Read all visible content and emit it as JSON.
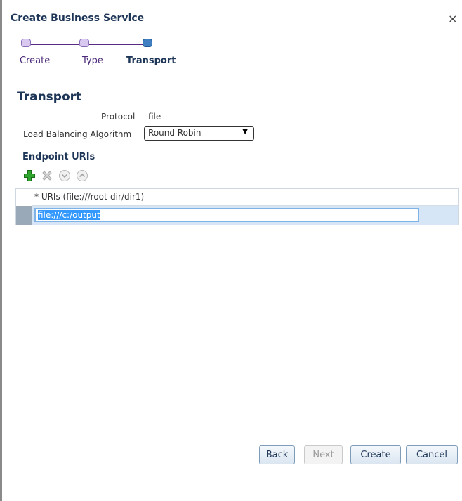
{
  "dialog": {
    "title": "Create Business Service",
    "close_label": "×"
  },
  "train": {
    "steps": [
      {
        "label": "Create",
        "state": "visited"
      },
      {
        "label": "Type",
        "state": "visited"
      },
      {
        "label": "Transport",
        "state": "current"
      }
    ]
  },
  "section": {
    "title": "Transport",
    "protocol_label": "Protocol",
    "protocol_value": "file",
    "lb_label": "Load Balancing Algorithm",
    "lb_value": "Round Robin"
  },
  "endpoints": {
    "title": "Endpoint URIs",
    "toolbar": [
      {
        "name": "add-icon",
        "enabled": true
      },
      {
        "name": "delete-icon",
        "enabled": false
      },
      {
        "name": "move-down-icon",
        "enabled": false
      },
      {
        "name": "move-up-icon",
        "enabled": false
      }
    ],
    "column_header": "* URIs (file:///root-dir/dir1)",
    "rows": [
      {
        "value": "file:///c:/output"
      }
    ]
  },
  "buttons": {
    "back": "Back",
    "next": "Next",
    "create": "Create",
    "cancel": "Cancel"
  },
  "colors": {
    "title": "#1d3557",
    "train_line": "#5a2b84",
    "selected_row": "#d6e6f6",
    "text_selection": "#3399ff"
  }
}
